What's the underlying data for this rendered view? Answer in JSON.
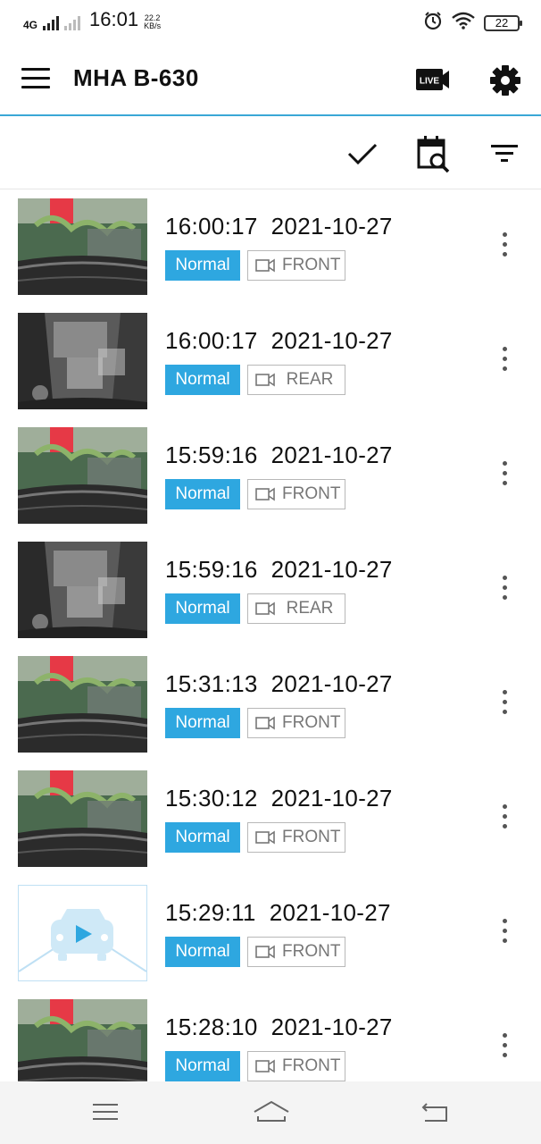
{
  "status_bar": {
    "network": "4G",
    "time": "16:01",
    "speed_value": "22.2",
    "speed_unit": "KB/s",
    "battery": "22",
    "icons": [
      "alarm-icon",
      "wifi-icon",
      "battery-icon"
    ]
  },
  "app_bar": {
    "title": "MHA B-630",
    "live_label": "LIVE",
    "icons": [
      "menu-icon",
      "live-camera-icon",
      "settings-gear-icon"
    ]
  },
  "toolbar": {
    "icons": [
      "checkmark-icon",
      "calendar-search-icon",
      "filter-icon"
    ]
  },
  "colors": {
    "accent": "#2ea7e0",
    "divider": "#3aa7d6"
  },
  "recordings": [
    {
      "time": "16:00:17",
      "date": "2021-10-27",
      "type": "Normal",
      "camera": "FRONT",
      "thumb": "front"
    },
    {
      "time": "16:00:17",
      "date": "2021-10-27",
      "type": "Normal",
      "camera": "REAR",
      "thumb": "rear"
    },
    {
      "time": "15:59:16",
      "date": "2021-10-27",
      "type": "Normal",
      "camera": "FRONT",
      "thumb": "front"
    },
    {
      "time": "15:59:16",
      "date": "2021-10-27",
      "type": "Normal",
      "camera": "REAR",
      "thumb": "rear"
    },
    {
      "time": "15:31:13",
      "date": "2021-10-27",
      "type": "Normal",
      "camera": "FRONT",
      "thumb": "front"
    },
    {
      "time": "15:30:12",
      "date": "2021-10-27",
      "type": "Normal",
      "camera": "FRONT",
      "thumb": "front"
    },
    {
      "time": "15:29:11",
      "date": "2021-10-27",
      "type": "Normal",
      "camera": "FRONT",
      "thumb": "placeholder"
    },
    {
      "time": "15:28:10",
      "date": "2021-10-27",
      "type": "Normal",
      "camera": "FRONT",
      "thumb": "front"
    }
  ],
  "nav_bar": {
    "icons": [
      "recent-apps-icon",
      "home-icon",
      "back-icon"
    ]
  }
}
